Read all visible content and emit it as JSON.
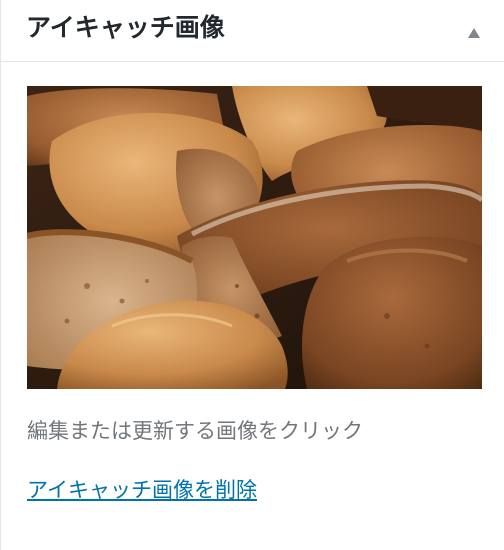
{
  "panel": {
    "title": "アイキャッチ画像",
    "toggle_icon": "triangle-up-icon"
  },
  "featured_image": {
    "subject": "bread-photo"
  },
  "help_text": "編集または更新する画像をクリック",
  "remove_link": "アイキャッチ画像を削除",
  "colors": {
    "title": "#23282d",
    "help_text": "#72777c",
    "link": "#0073aa",
    "border": "#e2e4e7"
  }
}
